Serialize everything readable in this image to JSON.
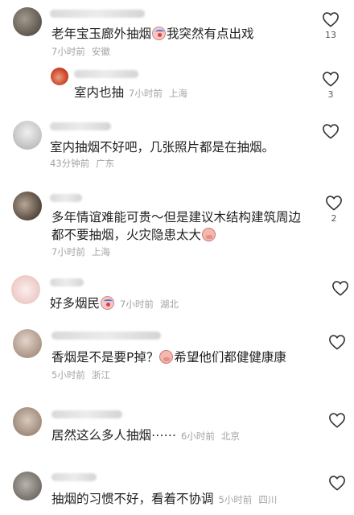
{
  "comments": [
    {
      "text": "老年宝玉廊外抽烟",
      "text_after": "我突然有点出戏",
      "emoji": "clown-face-emoji",
      "time": "7小时前",
      "location": "安徽",
      "likes": "13",
      "reply": {
        "text": "室内也抽",
        "time": "7小时前",
        "location": "上海",
        "likes": "3"
      }
    },
    {
      "text": "室内抽烟不好吧，几张照片都是在抽烟。",
      "time": "43分钟前",
      "location": "广东",
      "likes": ""
    },
    {
      "text": "多年情谊难能可贵～但是建议木结构建筑周边都不要抽烟，火灾隐患太大",
      "emoji": "pig-face-emoji",
      "time": "7小时前",
      "location": "上海",
      "likes": "2"
    },
    {
      "text": "好多烟民",
      "emoji": "clown-face-emoji",
      "time": "7小时前",
      "location": "湖北",
      "likes": ""
    },
    {
      "text": "香烟是不是要P掉？",
      "text_after": "希望他们都健健康康",
      "emoji": "pig-face-emoji",
      "time": "5小时前",
      "location": "浙江",
      "likes": ""
    },
    {
      "text": "居然这么多人抽烟⋯⋯",
      "time": "6小时前",
      "location": "北京",
      "likes": ""
    },
    {
      "text": "抽烟的习惯不好，看着不协调",
      "time": "5小时前",
      "location": "四川",
      "likes": ""
    }
  ],
  "avatar_colors": [
    "#6f6a62",
    "#d4462f",
    "#bdbdbd",
    "#7a6a5c",
    "#f2dcd8",
    "#c9b7aa",
    "#b7a496",
    "#8f8a84"
  ],
  "icons": {
    "like": "heart-outline-icon"
  }
}
